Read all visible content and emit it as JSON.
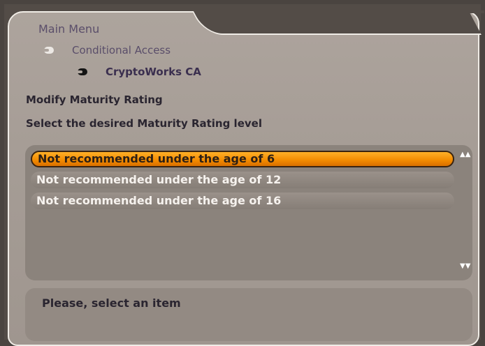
{
  "header": {
    "title": "Main Menu",
    "breadcrumbs": [
      {
        "label": "Conditional Access",
        "icon": "arrow-icon-light"
      },
      {
        "label": "CryptoWorks CA",
        "icon": "arrow-icon-dark"
      }
    ]
  },
  "content": {
    "heading": "Modify Maturity Rating",
    "instruction": "Select the desired Maturity Rating level"
  },
  "list": {
    "items": [
      {
        "label": "Not recommended under the age of 6",
        "selected": true
      },
      {
        "label": "Not recommended under the age of 12",
        "selected": false
      },
      {
        "label": "Not recommended under the age of 16",
        "selected": false
      }
    ],
    "scroll_up_icon": "▲▲",
    "scroll_down_icon": "▼▼"
  },
  "status": {
    "message": "Please, select an item"
  },
  "colors": {
    "selection": "#f28a00",
    "panel": "#a69d96",
    "background": "#534c47"
  }
}
